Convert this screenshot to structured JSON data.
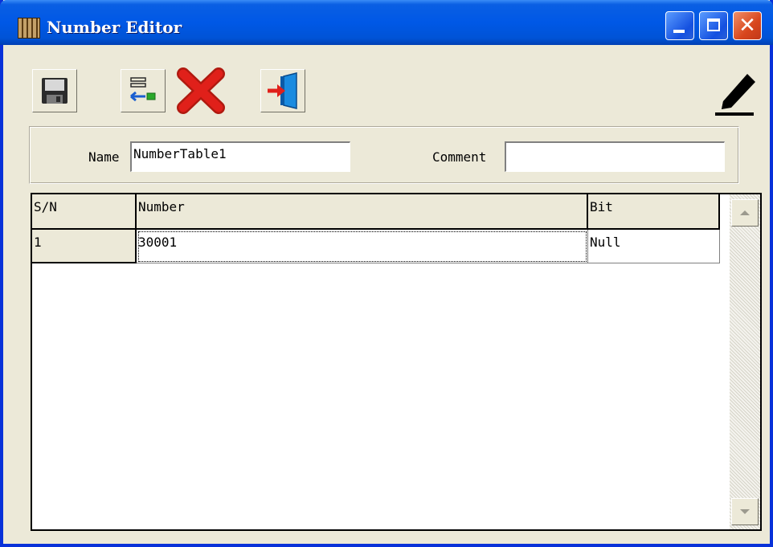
{
  "window": {
    "title": "Number Editor"
  },
  "toolbar": {
    "save": "save-icon",
    "insert": "insert-row-icon",
    "delete": "delete-icon",
    "exit": "exit-door-icon",
    "edit": "pencil-icon"
  },
  "form": {
    "name_label": "Name",
    "name_value": "NumberTable1",
    "comment_label": "Comment",
    "comment_value": ""
  },
  "table": {
    "columns": [
      "S/N",
      "Number",
      "Bit"
    ],
    "rows": [
      {
        "sn": "1",
        "number": "30001",
        "bit": "Null"
      }
    ]
  },
  "colors": {
    "titlebar": "#0058E6",
    "close_button": "#D8461C",
    "face": "#ECE9D8",
    "delete_icon": "#E0201A",
    "exit_icon": "#1A8BE0"
  }
}
